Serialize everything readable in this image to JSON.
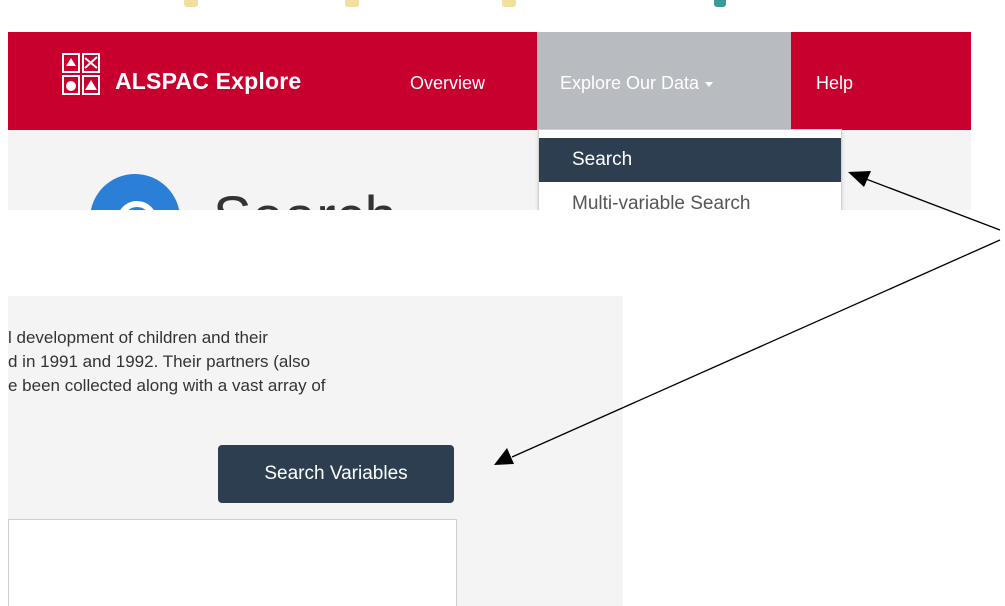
{
  "top_strip": {
    "chips": [
      {
        "color": "#f1df9f"
      },
      {
        "color": "#f1df9f"
      },
      {
        "color": "#f1df9f"
      },
      {
        "color": "#3a9a9a"
      }
    ]
  },
  "navbar": {
    "brand": "ALSPAC Explore",
    "links": {
      "overview": "Overview",
      "explore": "Explore Our Data",
      "help": "Help"
    },
    "color": "#c8002d"
  },
  "page": {
    "title": "Search"
  },
  "dropdown": {
    "items": [
      {
        "label": "Search",
        "active": true
      },
      {
        "label": "Multi-variable Search",
        "active": false
      }
    ]
  },
  "content": {
    "lines": [
      "l development of children and their",
      "d in 1991 and 1992. Their partners (also",
      "e been collected along with a vast array of"
    ],
    "search_button": "Search Variables"
  }
}
